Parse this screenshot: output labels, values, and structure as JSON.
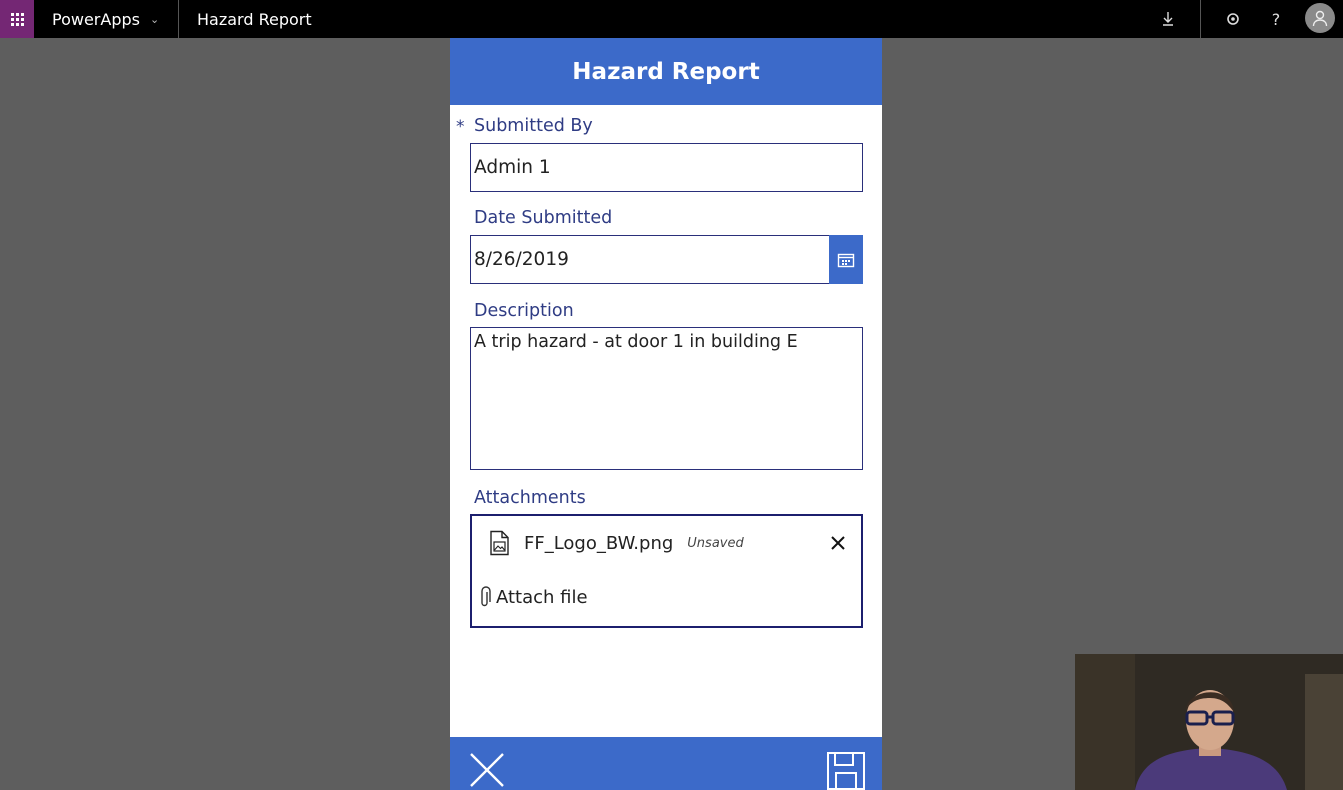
{
  "topbar": {
    "brand": "PowerApps",
    "app_title": "Hazard Report",
    "icons": [
      "waffle-icon",
      "chevron-down-icon",
      "download-icon",
      "settings-icon",
      "help-icon",
      "user-avatar-icon"
    ],
    "help_glyph": "?"
  },
  "form": {
    "title": "Hazard Report",
    "required_marker": "*",
    "submitted_by": {
      "label": "Submitted By",
      "value": "Admin 1"
    },
    "date_submitted": {
      "label": "Date Submitted",
      "value": "8/26/2019"
    },
    "description": {
      "label": "Description",
      "value": "A trip hazard - at door 1 in building E"
    },
    "attachments": {
      "label": "Attachments",
      "files": [
        {
          "name": "FF_Logo_BW.png",
          "status": "Unsaved"
        }
      ],
      "attach_label": "Attach file"
    }
  },
  "colors": {
    "accent": "#3c6ac9",
    "label_text": "#2f3c84",
    "topbar": "#000000",
    "waffle": "#742774",
    "backdrop": "#5e5e5e"
  }
}
